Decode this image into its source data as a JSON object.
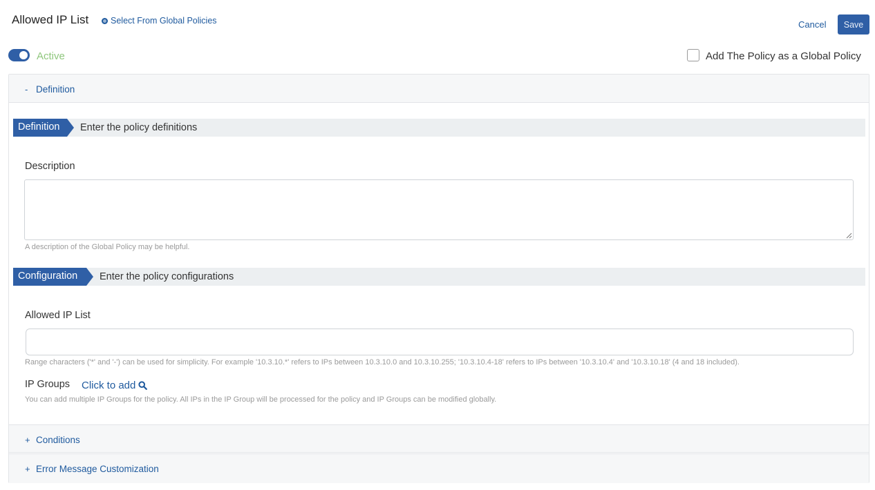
{
  "header": {
    "title": "Allowed IP List",
    "global_link": "Select From Global Policies",
    "cancel": "Cancel",
    "save": "Save"
  },
  "status": {
    "active_label": "Active",
    "active": true
  },
  "global_policy": {
    "label": "Add The Policy as a Global Policy",
    "checked": false
  },
  "panels": {
    "definition": {
      "sign": "-",
      "title": "Definition"
    },
    "conditions": {
      "sign": "+",
      "title": "Conditions"
    },
    "error": {
      "sign": "+",
      "title": "Error Message Customization"
    }
  },
  "definition_section": {
    "tag": "Definition",
    "desc": "Enter the policy definitions",
    "description_label": "Description",
    "description_value": "",
    "description_help": "A description of the Global Policy may be helpful."
  },
  "configuration_section": {
    "tag": "Configuration",
    "desc": "Enter the policy configurations",
    "ip_list_label": "Allowed IP List",
    "ip_list_value": "",
    "ip_list_help": "Range characters ('*' and '-') can be used for simplicity. For example '10.3.10.*' refers to IPs between 10.3.10.0 and 10.3.10.255; '10.3.10.4-18' refers to IPs between '10.3.10.4' and '10.3.10.18' (4 and 18 included).",
    "ip_groups_label": "IP Groups",
    "ip_groups_link": "Click to add",
    "ip_groups_help": "You can add multiple IP Groups for the policy. All IPs in the IP Group will be processed for the policy and IP Groups can be modified globally."
  },
  "colors": {
    "primary": "#2f5fa6",
    "link": "#1f5a9e",
    "active": "#8fc77d"
  },
  "icons": {
    "global_link": "globe-icon",
    "ip_groups": "search-icon"
  }
}
